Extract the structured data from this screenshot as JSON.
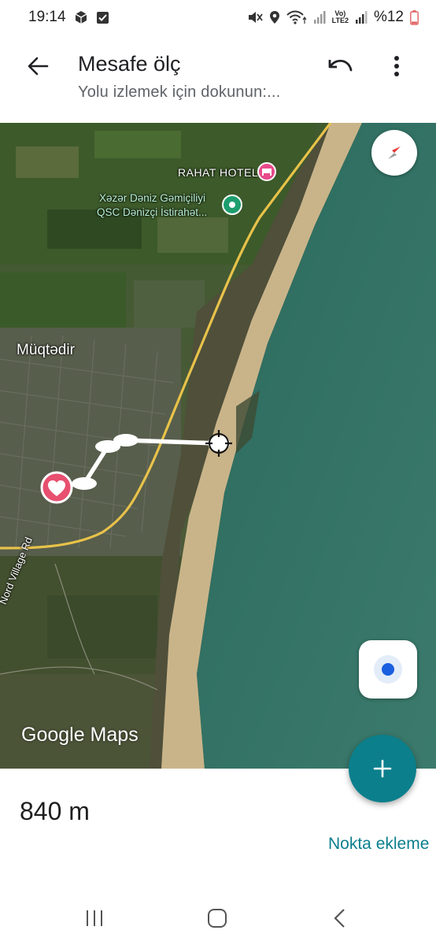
{
  "status_bar": {
    "time": "19:14",
    "battery": "%12",
    "lte_label": "LTE2",
    "icons": [
      "cube-icon",
      "checkbox-icon",
      "mute-icon",
      "location-icon",
      "wifi-icon",
      "signal-icon",
      "battery-icon"
    ]
  },
  "header": {
    "title": "Mesafe ölç",
    "subtitle": "Yolu izlemek için dokunun:...",
    "back_icon": "arrow-back-icon",
    "undo_icon": "undo-icon",
    "more_icon": "more-vert-icon"
  },
  "map": {
    "labels": {
      "hotel": "RAHAT HOTEL",
      "dock_line1": "Xəzər Dəniz Gəmiçiliyi",
      "dock_line2": "QSC Dənizçi İstirahət...",
      "town": "Müqtədir",
      "road": "Nord Village Rd"
    },
    "attribution": "Google Maps",
    "colors": {
      "sea": "#2f6b5e",
      "beach": "#c9b48a",
      "road": "#e8c24a",
      "pin_heart": "#e8506f",
      "poi_green": "#1e9e6e",
      "poi_pink": "#e84a8a"
    }
  },
  "measurement": {
    "distance": "840 m",
    "add_point": "Nokta ekleme"
  },
  "fab": {
    "icon": "plus-icon",
    "color": "#0b7f8c"
  },
  "nav": {
    "recent_icon": "recent-apps-icon",
    "home_icon": "home-icon",
    "back_icon": "nav-back-icon"
  }
}
